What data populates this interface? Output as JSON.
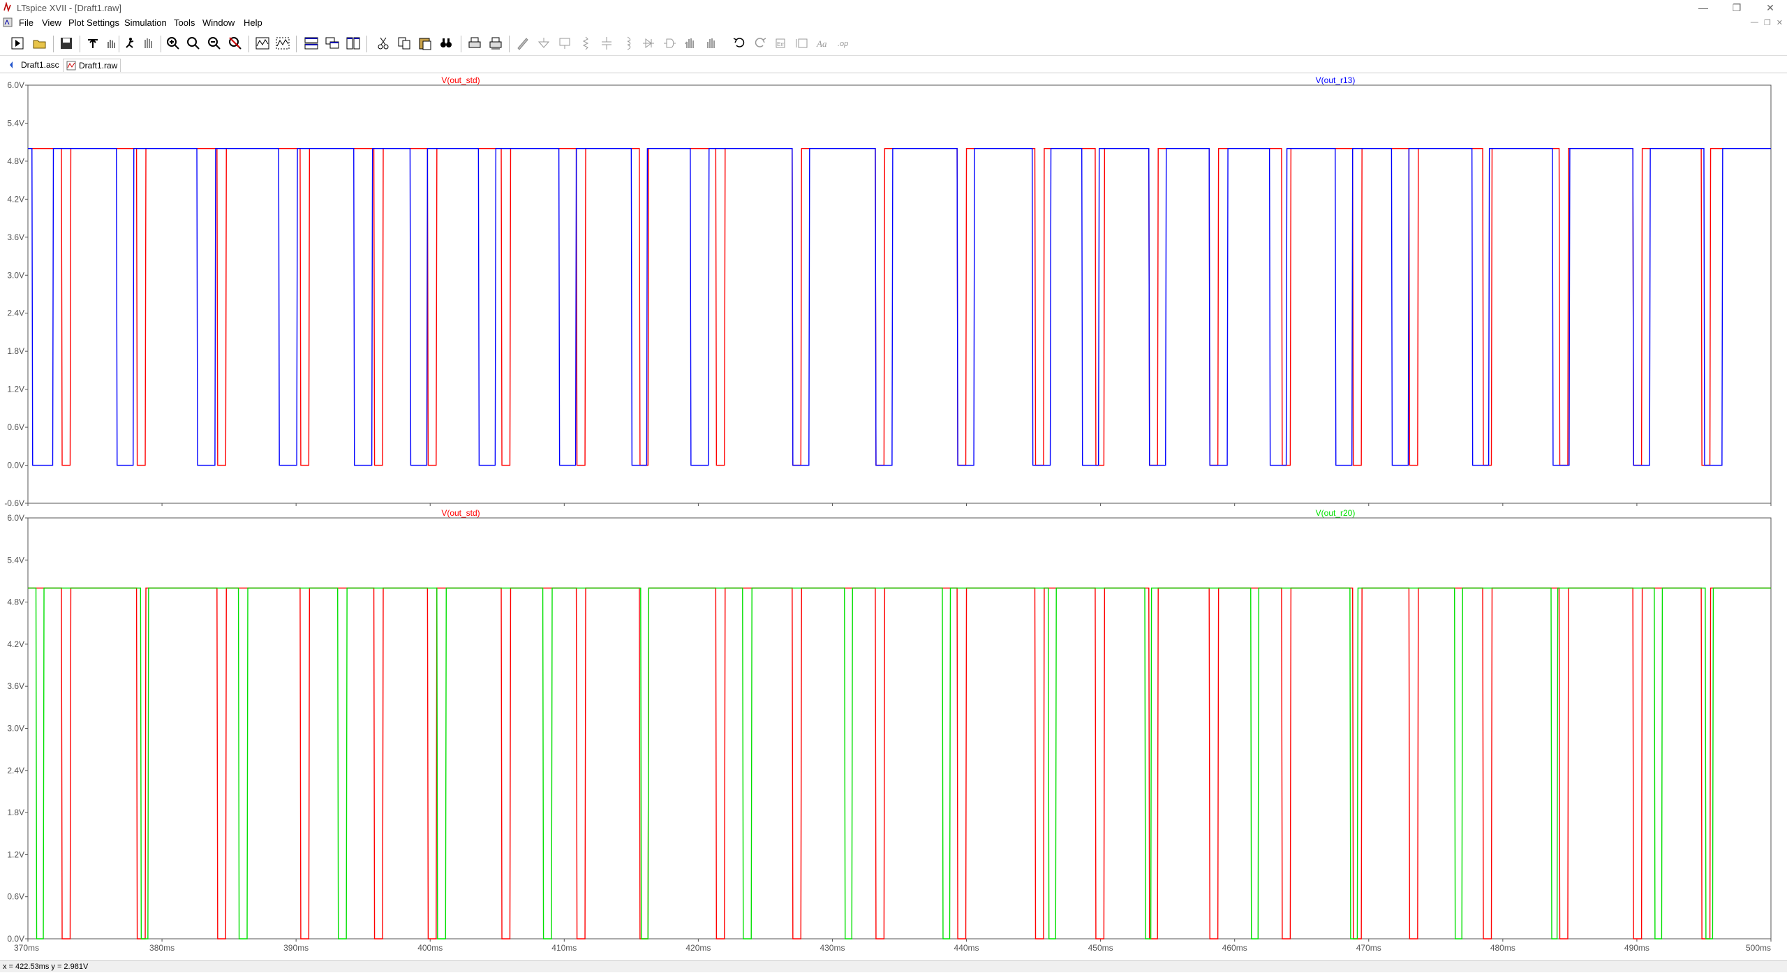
{
  "window": {
    "title": "LTspice XVII - [Draft1.raw]"
  },
  "menu": [
    "File",
    "View",
    "Plot Settings",
    "Simulation",
    "Tools",
    "Window",
    "Help"
  ],
  "tabs": [
    {
      "label": "Draft1.asc",
      "icon": "schematic-icon"
    },
    {
      "label": "Draft1.raw",
      "icon": "waveform-icon"
    }
  ],
  "colors": {
    "v_out_std": "#ff0000",
    "v_out_r13": "#0000ff",
    "v_out_r20": "#00e000"
  },
  "status": {
    "text": "x = 422.53ms   y = 2.981V"
  },
  "chart_data": [
    {
      "type": "line",
      "title": "",
      "xlabel": "",
      "ylabel": "",
      "xlim": [
        370,
        500
      ],
      "ylim": [
        -0.6,
        6.0
      ],
      "y_ticks": [
        "6.0V",
        "5.4V",
        "4.8V",
        "4.2V",
        "3.6V",
        "3.0V",
        "2.4V",
        "1.8V",
        "1.2V",
        "0.6V",
        "0.0V",
        "-0.6V"
      ],
      "series": [
        {
          "name": "V(out_std)",
          "color": "#ff0000",
          "high": 5.0,
          "low": 0.0,
          "low_intervals": [
            [
              372.5,
              373.2
            ],
            [
              378.1,
              378.8
            ],
            [
              384.1,
              384.8
            ],
            [
              390.3,
              391.0
            ],
            [
              395.8,
              396.5
            ],
            [
              399.8,
              400.5
            ],
            [
              405.3,
              406.0
            ],
            [
              410.9,
              411.6
            ],
            [
              415.6,
              416.3
            ],
            [
              421.3,
              422.0
            ],
            [
              427.0,
              427.7
            ],
            [
              433.2,
              433.9
            ],
            [
              439.3,
              440.0
            ],
            [
              445.1,
              445.8
            ],
            [
              449.6,
              450.3
            ],
            [
              453.6,
              454.3
            ],
            [
              458.1,
              458.8
            ],
            [
              463.5,
              464.2
            ],
            [
              468.8,
              469.5
            ],
            [
              473.0,
              473.7
            ],
            [
              478.5,
              479.2
            ],
            [
              484.2,
              484.9
            ],
            [
              489.7,
              490.4
            ],
            [
              494.8,
              495.5
            ]
          ]
        },
        {
          "name": "V(out_r13)",
          "color": "#0000ff",
          "high": 5.0,
          "low": 0.0,
          "low_intervals": [
            [
              370.3,
              371.9
            ],
            [
              376.6,
              377.9
            ],
            [
              382.6,
              384.0
            ],
            [
              388.7,
              390.1
            ],
            [
              394.3,
              395.7
            ],
            [
              398.5,
              399.8
            ],
            [
              403.6,
              404.9
            ],
            [
              409.6,
              410.9
            ],
            [
              415.0,
              416.2
            ],
            [
              419.4,
              420.8
            ],
            [
              427.0,
              428.3
            ],
            [
              433.2,
              434.5
            ],
            [
              439.3,
              440.6
            ],
            [
              444.9,
              446.3
            ],
            [
              448.6,
              449.9
            ],
            [
              453.6,
              454.9
            ],
            [
              458.1,
              459.5
            ],
            [
              462.6,
              463.9
            ],
            [
              467.5,
              468.8
            ],
            [
              471.7,
              473.0
            ],
            [
              477.7,
              479.0
            ],
            [
              483.7,
              485.0
            ],
            [
              489.7,
              491.0
            ],
            [
              495.0,
              496.4
            ]
          ]
        }
      ]
    },
    {
      "type": "line",
      "title": "",
      "xlabel": "",
      "ylabel": "",
      "xlim": [
        370,
        500
      ],
      "ylim": [
        0.0,
        6.0
      ],
      "x_ticks": [
        "370ms",
        "380ms",
        "390ms",
        "400ms",
        "410ms",
        "420ms",
        "430ms",
        "440ms",
        "450ms",
        "460ms",
        "470ms",
        "480ms",
        "490ms",
        "500ms"
      ],
      "y_ticks": [
        "6.0V",
        "5.4V",
        "4.8V",
        "4.2V",
        "3.6V",
        "3.0V",
        "2.4V",
        "1.8V",
        "1.2V",
        "0.6V",
        "0.0V"
      ],
      "series": [
        {
          "name": "V(out_std)",
          "color": "#ff0000",
          "high": 5.0,
          "low": 0.0,
          "low_intervals": [
            [
              372.5,
              373.2
            ],
            [
              378.1,
              378.8
            ],
            [
              384.1,
              384.8
            ],
            [
              390.3,
              391.0
            ],
            [
              395.8,
              396.5
            ],
            [
              399.8,
              400.5
            ],
            [
              405.3,
              406.0
            ],
            [
              410.9,
              411.6
            ],
            [
              415.6,
              416.3
            ],
            [
              421.3,
              422.0
            ],
            [
              427.0,
              427.7
            ],
            [
              433.2,
              433.9
            ],
            [
              439.3,
              440.0
            ],
            [
              445.1,
              445.8
            ],
            [
              449.6,
              450.3
            ],
            [
              453.6,
              454.3
            ],
            [
              458.1,
              458.8
            ],
            [
              463.5,
              464.2
            ],
            [
              468.8,
              469.5
            ],
            [
              473.0,
              473.7
            ],
            [
              478.5,
              479.2
            ],
            [
              484.2,
              484.9
            ],
            [
              489.7,
              490.4
            ],
            [
              494.8,
              495.5
            ]
          ]
        },
        {
          "name": "V(out_r20)",
          "color": "#00e000",
          "high": 5.0,
          "low": 0.0,
          "low_intervals": [
            [
              370.6,
              371.2
            ],
            [
              378.4,
              379.0
            ],
            [
              385.7,
              386.4
            ],
            [
              393.1,
              393.8
            ],
            [
              400.5,
              401.2
            ],
            [
              408.4,
              409.1
            ],
            [
              415.7,
              416.3
            ],
            [
              423.3,
              424.0
            ],
            [
              430.9,
              431.5
            ],
            [
              438.2,
              438.8
            ],
            [
              446.1,
              446.7
            ],
            [
              453.3,
              453.8
            ],
            [
              461.2,
              461.8
            ],
            [
              468.6,
              469.2
            ],
            [
              476.4,
              477.0
            ],
            [
              483.6,
              484.1
            ],
            [
              491.3,
              491.9
            ],
            [
              495.1,
              495.7
            ]
          ]
        }
      ]
    }
  ]
}
